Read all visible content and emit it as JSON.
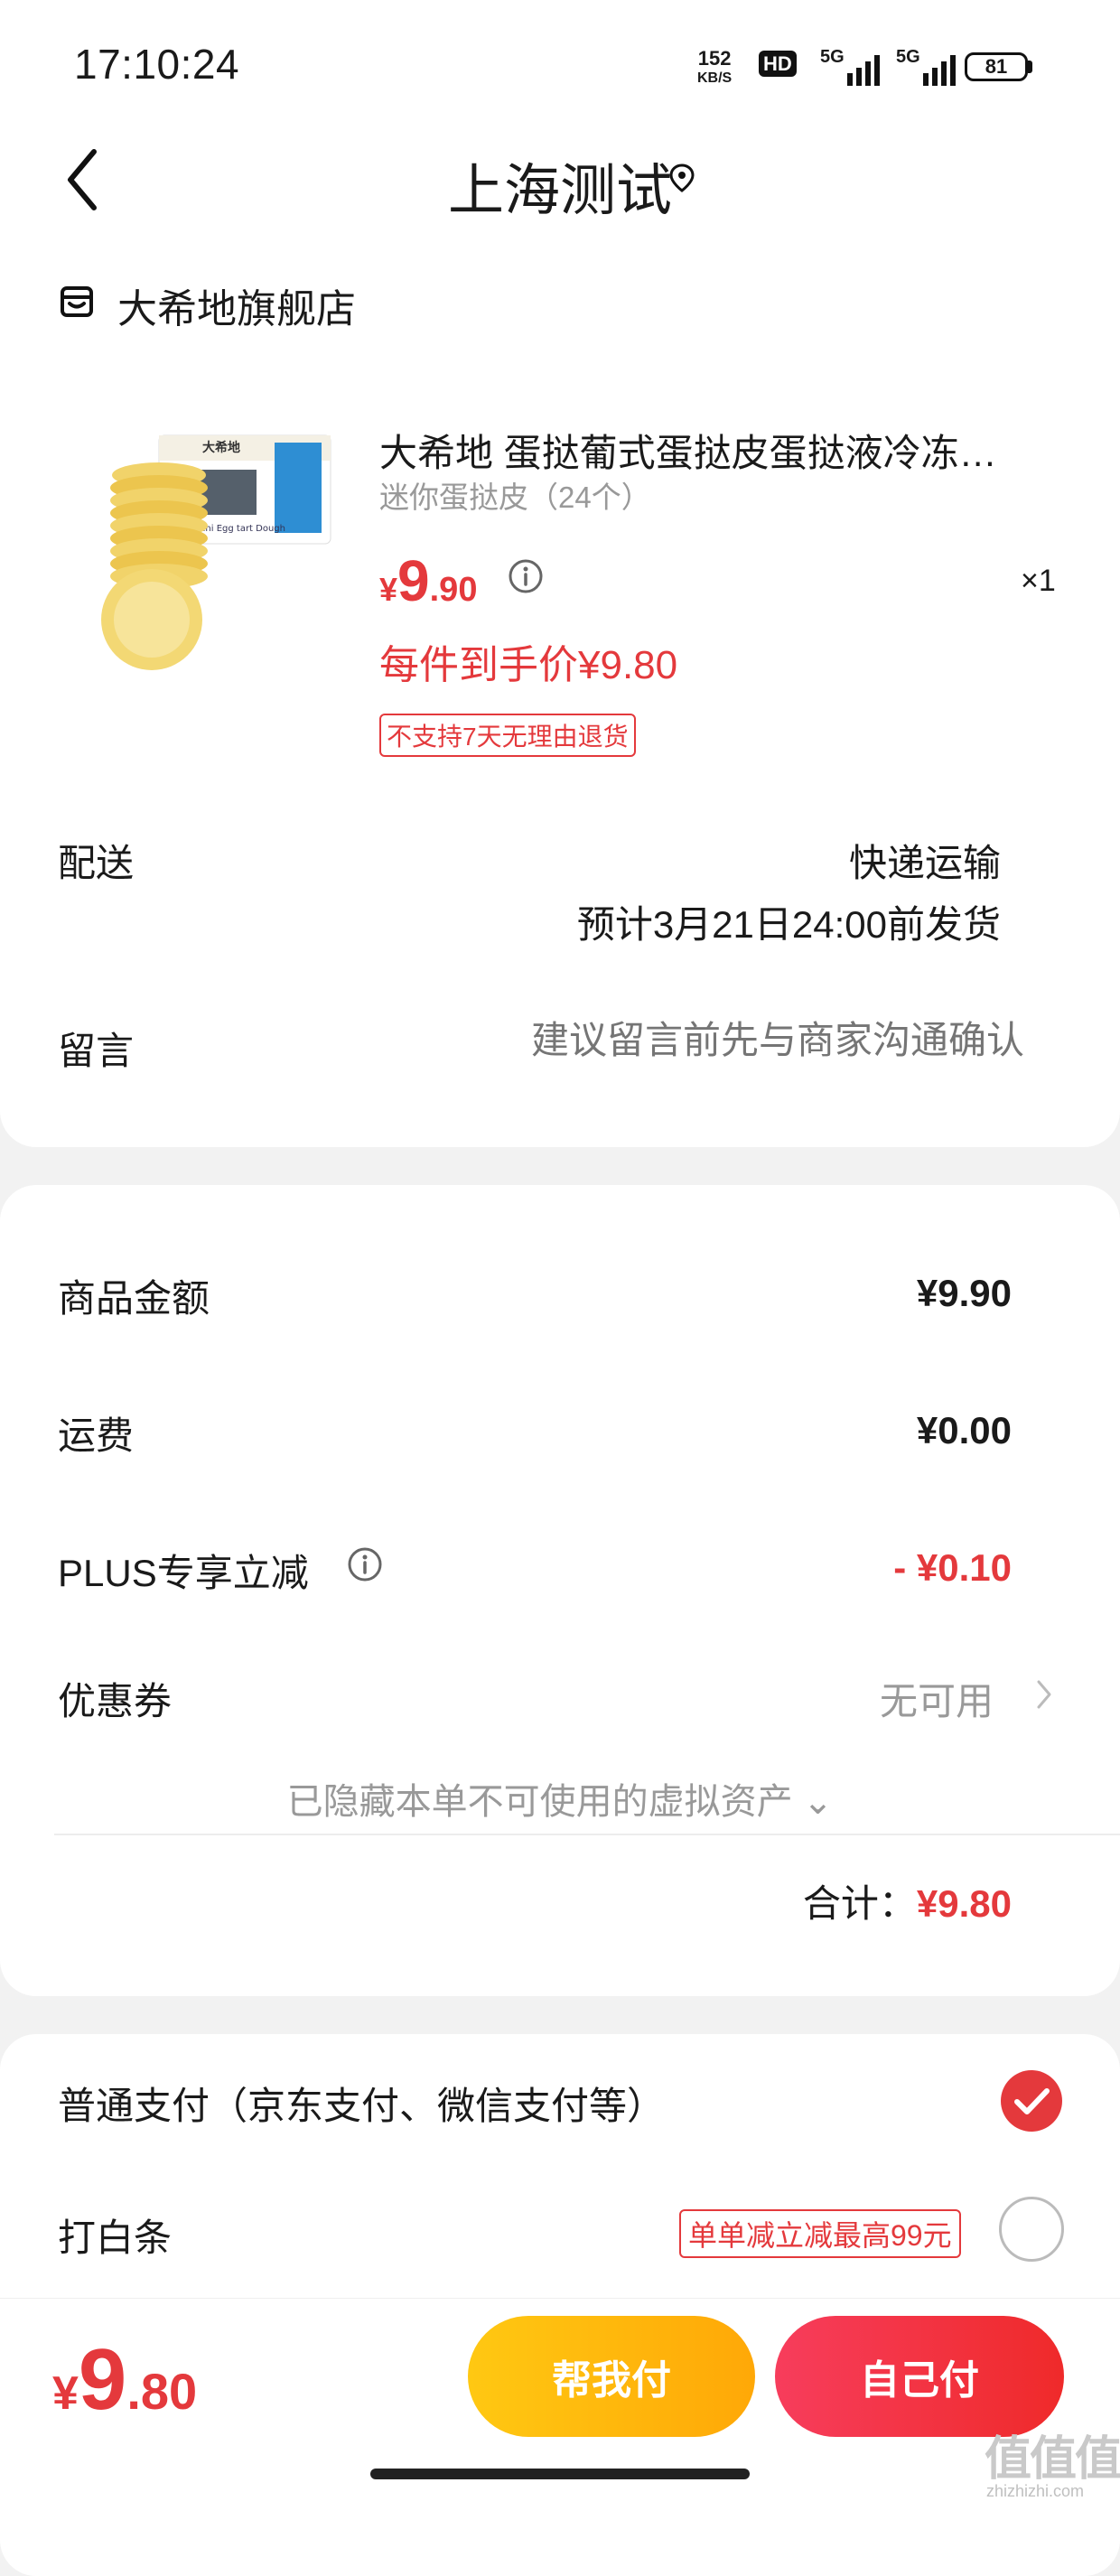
{
  "status_bar": {
    "time": "17:10:24",
    "net_speed_value": "152",
    "net_speed_unit": "KB/S",
    "hd_badge": "HD",
    "sim1_label": "5G",
    "sim2_label": "5G",
    "battery": "81"
  },
  "nav": {
    "title": "上海测试",
    "back_icon": "chevron-left-icon",
    "location_icon": "location-pin-icon"
  },
  "store": {
    "icon": "store-icon",
    "name": "大希地旗舰店"
  },
  "product": {
    "title": "大希地 蛋挞葡式蛋挞皮蛋挞液冷冻…",
    "spec": "迷你蛋挞皮（24个）",
    "price_currency": "¥",
    "price_int": "9",
    "price_dec": ".90",
    "quantity": "×1",
    "net_price": "每件到手价¥9.80",
    "return_policy": "不支持7天无理由退货",
    "image_box_text": "大希地",
    "image_box_subtext": "Mini Egg tart Dough"
  },
  "delivery": {
    "label": "配送",
    "method": "快递运输",
    "eta": "预计3月21日24:00前发货"
  },
  "message": {
    "label": "留言",
    "placeholder": "建议留言前先与商家沟通确认"
  },
  "summary": {
    "goods_label": "商品金额",
    "goods_value": "¥9.90",
    "shipping_label": "运费",
    "shipping_value": "¥0.00",
    "plus_label": "PLUS专享立减",
    "plus_value": "- ¥0.10",
    "coupon_label": "优惠券",
    "coupon_value": "无可用",
    "hidden_assets": "已隐藏本单不可使用的虚拟资产 ⌄",
    "total_label": "合计：",
    "total_value": "¥9.80"
  },
  "payment": {
    "normal_label": "普通支付（京东支付、微信支付等）",
    "normal_selected": true,
    "baitiao_label": "打白条",
    "baitiao_promo": "单单减立减最高99元",
    "baitiao_selected": false
  },
  "bottom_bar": {
    "price_currency": "¥",
    "price_int": "9",
    "price_dec": ".80",
    "help_pay_label": "帮我付",
    "self_pay_label": "自己付"
  },
  "watermark": {
    "text": "值值值",
    "sub": "zhizhizhi.com"
  },
  "colors": {
    "accent_red": "#e4393c",
    "help_pay_yellow": "#ffb60c",
    "self_pay_red": "#f2324a"
  }
}
